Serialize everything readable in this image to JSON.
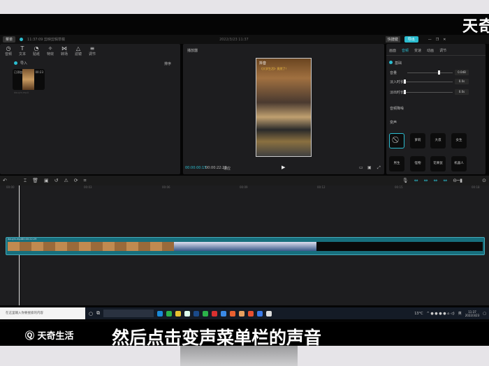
{
  "watermark": "天奇",
  "app": {
    "menu_label": "菜单",
    "project_title": "11:37:09 剪映剪辑草稿",
    "date": "2022/3/23 11:37",
    "export_label": "导出",
    "shortcut_label": "快捷键"
  },
  "left_panel": {
    "tools": [
      {
        "icon": "media-icon",
        "label": "音频"
      },
      {
        "icon": "text-icon",
        "label": "文本"
      },
      {
        "icon": "sticker-icon",
        "label": "贴纸"
      },
      {
        "icon": "effect-icon",
        "label": "特效"
      },
      {
        "icon": "transition-icon",
        "label": "转场"
      },
      {
        "icon": "filter-icon",
        "label": "滤镜"
      },
      {
        "icon": "adjust-icon",
        "label": "调节"
      }
    ],
    "import_label": "导入",
    "sort_label": "排序",
    "clip": {
      "label": "已添加",
      "duration": "00:23",
      "name": "douyin.mp4"
    }
  },
  "player": {
    "title": "播放器",
    "current_time": "00:00:00:15",
    "total_time": "00:00:22:29",
    "ratio_label": "适应",
    "video_header": "抖音",
    "video_caption": "《大学生活》· 竟然了！"
  },
  "right_panel": {
    "tabs": [
      "画面",
      "音频",
      "变速",
      "动画",
      "调节"
    ],
    "active_tab": 1,
    "basic_label": "基础",
    "volume_label": "音量",
    "volume_value": "0.0dB",
    "fade_in_label": "淡入时长",
    "fade_in_value": "0.0s",
    "fade_out_label": "淡出时长",
    "fade_out_value": "0.0s",
    "normalize_label": "音频降噪",
    "voice_change_label": "变声",
    "voices": [
      "无",
      "萝莉",
      "大叔",
      "女生",
      "男生",
      "怪物",
      "花栗鼠",
      "机器人"
    ],
    "selected_voice": 0
  },
  "timeline": {
    "ticks": [
      "00:00",
      "00:03",
      "00:06",
      "00:09",
      "00:12",
      "00:15",
      "00:18"
    ],
    "clip_name": "douyin.mp4",
    "clip_duration": "00:00:22:29"
  },
  "taskbar": {
    "search_placeholder": "在这里输入你要搜索的内容",
    "weather": "13°C",
    "time": "11:37",
    "date": "2022/3/23",
    "lang": "英"
  },
  "caption": {
    "logo": "天奇生活",
    "text": "然后点击变声菜单栏的声音"
  },
  "colors": {
    "accent": "#2bbdd0",
    "track": "#176f7d"
  }
}
